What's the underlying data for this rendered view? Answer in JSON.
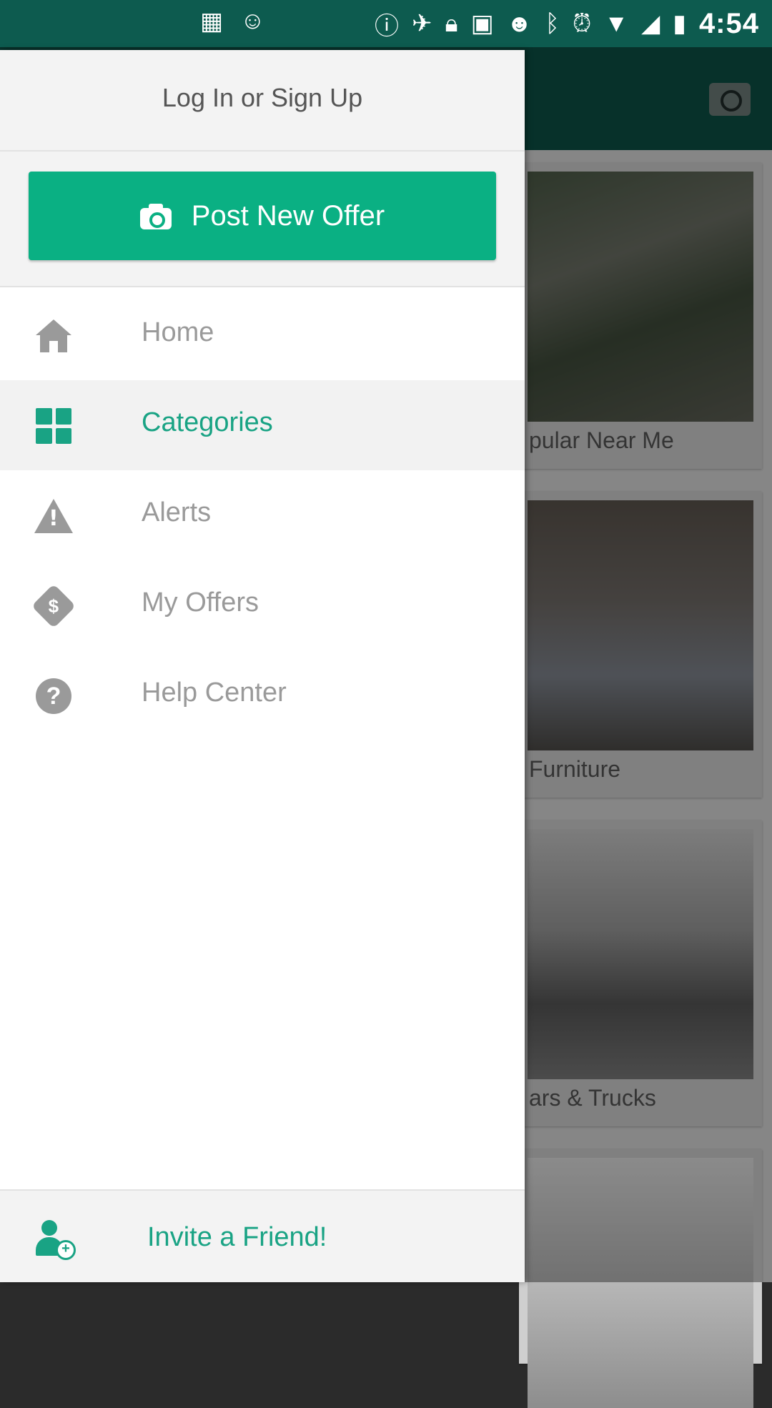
{
  "status_bar": {
    "time": "4:54",
    "left_icons": [
      "grid-icon",
      "smile-icon"
    ],
    "right_icons": [
      "info-icon",
      "satellite-icon",
      "lock-icon",
      "android-icon",
      "smile-icon",
      "bluetooth-icon",
      "alarm-icon",
      "wifi-icon",
      "no-signal-icon",
      "battery-icon"
    ]
  },
  "app": {
    "cards": [
      {
        "caption": "pular Near Me"
      },
      {
        "caption": "Furniture"
      },
      {
        "caption": "ars & Trucks"
      },
      {
        "caption": ""
      }
    ]
  },
  "drawer": {
    "login_label": "Log In or Sign Up",
    "post_button_label": "Post New Offer",
    "menu": [
      {
        "label": "Home",
        "icon": "home-icon",
        "active": false
      },
      {
        "label": "Categories",
        "icon": "categories-icon",
        "active": true
      },
      {
        "label": "Alerts",
        "icon": "alert-icon",
        "active": false
      },
      {
        "label": "My Offers",
        "icon": "price-tag-icon",
        "active": false
      },
      {
        "label": "Help Center",
        "icon": "help-icon",
        "active": false
      }
    ],
    "footer_label": "Invite a Friend!",
    "footer_icon": "add-user-icon"
  },
  "colors": {
    "accent": "#0ab083",
    "accent_text": "#19a384",
    "header": "#0c4f45"
  }
}
